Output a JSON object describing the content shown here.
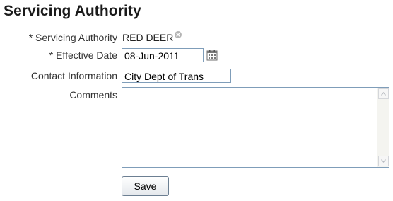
{
  "page": {
    "title": "Servicing Authority"
  },
  "form": {
    "servicing_authority": {
      "label": "* Servicing Authority",
      "value": "RED DEER",
      "clear_icon": "clear-x-circle-icon"
    },
    "effective_date": {
      "label": "* Effective Date",
      "value": "08-Jun-2011",
      "picker_icon": "calendar-icon"
    },
    "contact_information": {
      "label": "Contact Information",
      "value": "City Dept of Trans"
    },
    "comments": {
      "label": "Comments",
      "value": ""
    },
    "save_label": "Save"
  },
  "colors": {
    "input_border": "#7f9db9",
    "label_text": "#333333"
  }
}
